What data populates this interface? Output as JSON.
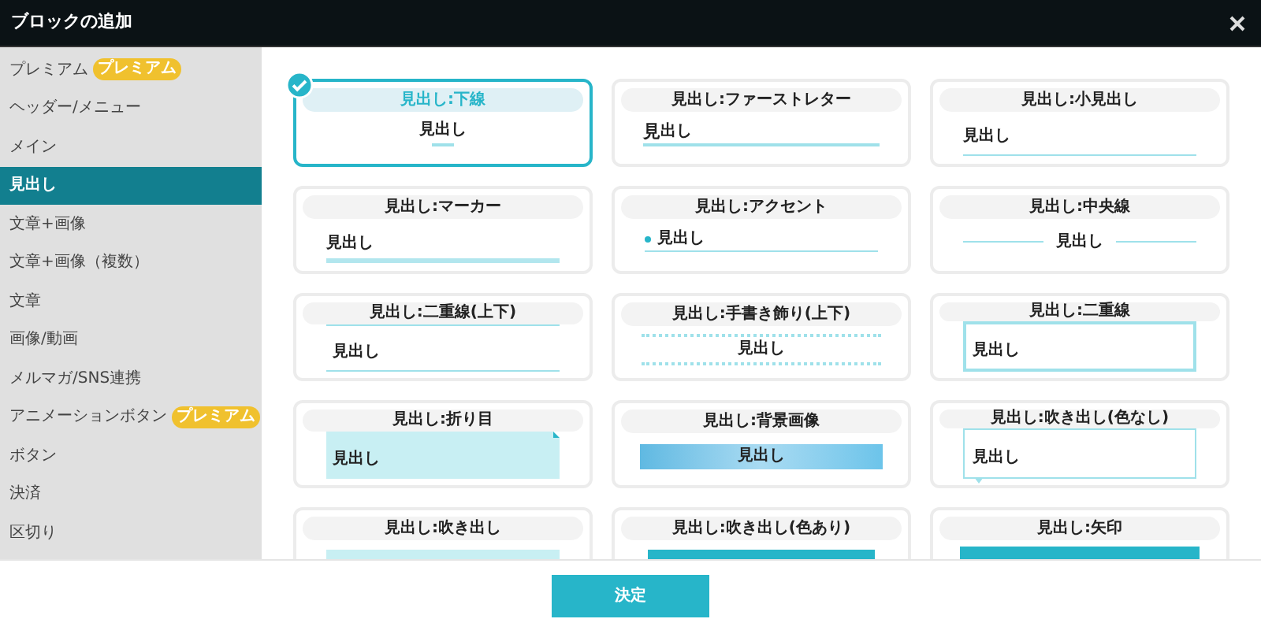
{
  "window": {
    "title": "ブロックの追加"
  },
  "sidebar": {
    "items": [
      {
        "label": "プレミアム",
        "badge": "プレミアム",
        "selected": false
      },
      {
        "label": "ヘッダー/メニュー",
        "selected": false
      },
      {
        "label": "メイン",
        "selected": false
      },
      {
        "label": "見出し",
        "selected": true
      },
      {
        "label": "文章+画像",
        "selected": false
      },
      {
        "label": "文章+画像（複数）",
        "selected": false
      },
      {
        "label": "文章",
        "selected": false
      },
      {
        "label": "画像/動画",
        "selected": false
      },
      {
        "label": "メルマガ/SNS連携",
        "selected": false
      },
      {
        "label": "アニメーションボタン",
        "badge": "プレミアム",
        "selected": false
      },
      {
        "label": "ボタン",
        "selected": false
      },
      {
        "label": "決済",
        "selected": false
      },
      {
        "label": "区切り",
        "selected": false
      }
    ]
  },
  "blocks": [
    {
      "title": "見出し:下線",
      "kind": "underline",
      "preview_text": "見出し",
      "selected": true
    },
    {
      "title": "見出し:ファーストレター",
      "kind": "first-letter",
      "preview_first": "見",
      "preview_text": "出し",
      "selected": false
    },
    {
      "title": "見出し:小見出し",
      "kind": "small",
      "preview_text": "見出し",
      "selected": false
    },
    {
      "title": "見出し:マーカー",
      "kind": "marker",
      "preview_text": "見出し",
      "selected": false
    },
    {
      "title": "見出し:アクセント",
      "kind": "accent",
      "preview_text": "見出し",
      "selected": false
    },
    {
      "title": "見出し:中央線",
      "kind": "center-line",
      "preview_text": "見出し",
      "selected": false
    },
    {
      "title": "見出し:二重線(上下)",
      "kind": "double",
      "preview_text": "見出し",
      "selected": false
    },
    {
      "title": "見出し:手書き飾り(上下)",
      "kind": "handwritten",
      "preview_text": "見出し",
      "selected": false
    },
    {
      "title": "見出し:二重線",
      "kind": "double-border",
      "preview_text": "見出し",
      "selected": false
    },
    {
      "title": "見出し:折り目",
      "kind": "fold",
      "preview_text": "見出し",
      "selected": false
    },
    {
      "title": "見出し:背景画像",
      "kind": "bg-image",
      "preview_text": "見出し",
      "selected": false
    },
    {
      "title": "見出し:吹き出し(色なし)",
      "kind": "balloon-plain",
      "preview_text": "見出し",
      "selected": false
    },
    {
      "title": "見出し:吹き出し",
      "kind": "balloon",
      "selected": false
    },
    {
      "title": "見出し:吹き出し(色あり)",
      "kind": "balloon-colored",
      "selected": false
    },
    {
      "title": "見出し:矢印",
      "kind": "arrow",
      "selected": false
    }
  ],
  "footer": {
    "confirm_button": "決定"
  }
}
